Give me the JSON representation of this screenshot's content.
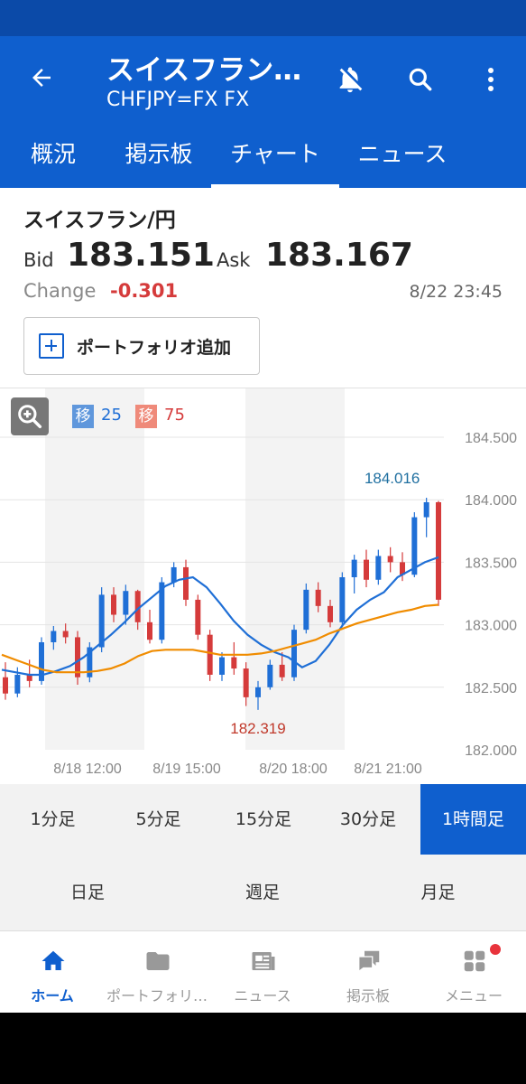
{
  "header": {
    "title": "スイスフラン…",
    "subtitle": "CHFJPY=FX FX"
  },
  "tabs": [
    {
      "label": "概況"
    },
    {
      "label": "掲示板"
    },
    {
      "label": "チャート"
    },
    {
      "label": "ニュース"
    }
  ],
  "quote": {
    "name": "スイスフラン/円",
    "bid_label": "Bid",
    "bid": "183.151",
    "ask_label": "Ask",
    "ask": "183.167",
    "change_label": "Change",
    "change": "-0.301",
    "timestamp": "8/22 23:45"
  },
  "portfolio_button": "ポートフォリオ追加",
  "moving_averages": [
    {
      "badge": "移",
      "period": "25",
      "color": "#1f6fd6"
    },
    {
      "badge": "移",
      "period": "75",
      "color": "#f08c00"
    }
  ],
  "chart_data": {
    "type": "candlestick",
    "y_ticks": [
      "184.500",
      "184.000",
      "183.500",
      "183.000",
      "182.500",
      "182.000"
    ],
    "ylim": [
      182.0,
      184.5
    ],
    "x_ticks": [
      "8/18 12:00",
      "8/19 15:00",
      "8/20 18:00",
      "8/21 21:00"
    ],
    "annotations": [
      {
        "label": "184.016",
        "value": 184.016,
        "kind": "high"
      },
      {
        "label": "182.319",
        "value": 182.319,
        "kind": "low"
      }
    ],
    "series": [
      {
        "name": "移25",
        "type": "line",
        "color": "#1f6fd6",
        "values": [
          182.64,
          182.62,
          182.6,
          182.6,
          182.63,
          182.67,
          182.74,
          182.83,
          182.92,
          183.02,
          183.13,
          183.22,
          183.31,
          183.36,
          183.38,
          183.3,
          183.17,
          183.03,
          182.92,
          182.84,
          182.78,
          182.74,
          182.66,
          182.71,
          182.84,
          183.0,
          183.12,
          183.2,
          183.26,
          183.38,
          183.44,
          183.5,
          183.54
        ]
      },
      {
        "name": "移75",
        "type": "line",
        "color": "#f08c00",
        "values": [
          182.76,
          182.72,
          182.68,
          182.64,
          182.62,
          182.62,
          182.62,
          182.63,
          182.65,
          182.69,
          182.75,
          182.79,
          182.8,
          182.8,
          182.8,
          182.78,
          182.76,
          182.76,
          182.76,
          182.77,
          182.79,
          182.82,
          182.85,
          182.88,
          182.93,
          182.97,
          183.01,
          183.04,
          183.07,
          183.1,
          183.12,
          183.15,
          183.16
        ]
      }
    ],
    "candles": [
      {
        "o": 182.58,
        "h": 182.7,
        "l": 182.4,
        "c": 182.45
      },
      {
        "o": 182.45,
        "h": 182.66,
        "l": 182.42,
        "c": 182.6
      },
      {
        "o": 182.6,
        "h": 182.72,
        "l": 182.5,
        "c": 182.55
      },
      {
        "o": 182.55,
        "h": 182.9,
        "l": 182.52,
        "c": 182.86
      },
      {
        "o": 182.86,
        "h": 182.99,
        "l": 182.8,
        "c": 182.95
      },
      {
        "o": 182.95,
        "h": 183.01,
        "l": 182.85,
        "c": 182.9
      },
      {
        "o": 182.9,
        "h": 182.95,
        "l": 182.52,
        "c": 182.58
      },
      {
        "o": 182.58,
        "h": 182.86,
        "l": 182.54,
        "c": 182.82
      },
      {
        "o": 182.82,
        "h": 183.3,
        "l": 182.78,
        "c": 183.24
      },
      {
        "o": 183.24,
        "h": 183.3,
        "l": 183.02,
        "c": 183.08
      },
      {
        "o": 183.08,
        "h": 183.32,
        "l": 183.0,
        "c": 183.27
      },
      {
        "o": 183.27,
        "h": 183.28,
        "l": 182.96,
        "c": 183.02
      },
      {
        "o": 183.02,
        "h": 183.12,
        "l": 182.85,
        "c": 182.88
      },
      {
        "o": 182.88,
        "h": 183.38,
        "l": 182.85,
        "c": 183.34
      },
      {
        "o": 183.34,
        "h": 183.5,
        "l": 183.3,
        "c": 183.46
      },
      {
        "o": 183.46,
        "h": 183.52,
        "l": 183.15,
        "c": 183.2
      },
      {
        "o": 183.2,
        "h": 183.24,
        "l": 182.88,
        "c": 182.92
      },
      {
        "o": 182.92,
        "h": 182.96,
        "l": 182.55,
        "c": 182.6
      },
      {
        "o": 182.6,
        "h": 182.78,
        "l": 182.55,
        "c": 182.74
      },
      {
        "o": 182.74,
        "h": 182.86,
        "l": 182.6,
        "c": 182.65
      },
      {
        "o": 182.65,
        "h": 182.7,
        "l": 182.35,
        "c": 182.42
      },
      {
        "o": 182.42,
        "h": 182.55,
        "l": 182.319,
        "c": 182.5
      },
      {
        "o": 182.5,
        "h": 182.72,
        "l": 182.48,
        "c": 182.68
      },
      {
        "o": 182.68,
        "h": 182.78,
        "l": 182.55,
        "c": 182.58
      },
      {
        "o": 182.58,
        "h": 183.0,
        "l": 182.55,
        "c": 182.96
      },
      {
        "o": 182.96,
        "h": 183.33,
        "l": 182.93,
        "c": 183.28
      },
      {
        "o": 183.28,
        "h": 183.34,
        "l": 183.1,
        "c": 183.15
      },
      {
        "o": 183.15,
        "h": 183.2,
        "l": 182.98,
        "c": 183.02
      },
      {
        "o": 183.02,
        "h": 183.42,
        "l": 183.0,
        "c": 183.38
      },
      {
        "o": 183.38,
        "h": 183.56,
        "l": 183.25,
        "c": 183.52
      },
      {
        "o": 183.52,
        "h": 183.6,
        "l": 183.3,
        "c": 183.36
      },
      {
        "o": 183.36,
        "h": 183.6,
        "l": 183.32,
        "c": 183.55
      },
      {
        "o": 183.55,
        "h": 183.62,
        "l": 183.42,
        "c": 183.5
      },
      {
        "o": 183.5,
        "h": 183.58,
        "l": 183.35,
        "c": 183.4
      },
      {
        "o": 183.4,
        "h": 183.9,
        "l": 183.38,
        "c": 183.86
      },
      {
        "o": 183.86,
        "h": 184.016,
        "l": 183.7,
        "c": 183.98
      },
      {
        "o": 183.98,
        "h": 183.99,
        "l": 183.15,
        "c": 183.2
      }
    ]
  },
  "timeframes_row1": [
    {
      "label": "1分足",
      "active": false
    },
    {
      "label": "5分足",
      "active": false
    },
    {
      "label": "15分足",
      "active": false
    },
    {
      "label": "30分足",
      "active": false
    },
    {
      "label": "1時間足",
      "active": true
    }
  ],
  "timeframes_row2": [
    {
      "label": "日足"
    },
    {
      "label": "週足"
    },
    {
      "label": "月足"
    }
  ],
  "bottom_nav": [
    {
      "label": "ホーム",
      "icon": "home-icon",
      "active": true
    },
    {
      "label": "ポートフォリ…",
      "icon": "folder-icon",
      "active": false
    },
    {
      "label": "ニュース",
      "icon": "news-icon",
      "active": false
    },
    {
      "label": "掲示板",
      "icon": "chat-icon",
      "active": false
    },
    {
      "label": "メニュー",
      "icon": "menu-grid-icon",
      "active": false
    }
  ]
}
